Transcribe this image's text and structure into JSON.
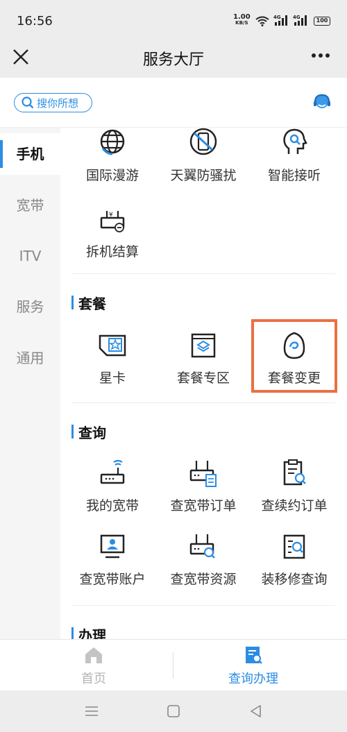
{
  "status_bar": {
    "time": "16:56",
    "speed": "1.00",
    "speed_unit": "KB/S",
    "signal1": "4G",
    "signal2": "4G",
    "battery": "100"
  },
  "header": {
    "title": "服务大厅",
    "close_icon": "close-icon",
    "more_icon": "more-icon"
  },
  "search": {
    "placeholder": "搜你所想",
    "icon": "search-icon",
    "service_icon": "customer-service-icon"
  },
  "sidebar": {
    "items": [
      {
        "label": "手机",
        "active": true
      },
      {
        "label": "宽带"
      },
      {
        "label": "ITV"
      },
      {
        "label": "服务"
      },
      {
        "label": "通用"
      }
    ]
  },
  "main": {
    "top_items": [
      {
        "label": "国际漫游",
        "icon": "globe-icon"
      },
      {
        "label": "天翼防骚扰",
        "icon": "phone-block-icon"
      },
      {
        "label": "智能接听",
        "icon": "ai-head-icon"
      },
      {
        "label": "拆机结算",
        "icon": "router-settle-icon"
      }
    ],
    "package_section": {
      "title": "套餐",
      "items": [
        {
          "label": "星卡",
          "icon": "sim-star-icon"
        },
        {
          "label": "套餐专区",
          "icon": "package-box-icon"
        },
        {
          "label": "套餐变更",
          "icon": "egg-swirl-icon"
        }
      ]
    },
    "query_section": {
      "title": "查询",
      "items": [
        {
          "label": "我的宽带",
          "icon": "router-wifi-icon"
        },
        {
          "label": "查宽带订单",
          "icon": "router-doc-icon"
        },
        {
          "label": "查续约订单",
          "icon": "clipboard-search-icon"
        },
        {
          "label": "查宽带账户",
          "icon": "monitor-user-icon"
        },
        {
          "label": "查宽带资源",
          "icon": "router-search-icon"
        },
        {
          "label": "装移修查询",
          "icon": "list-search-icon"
        }
      ]
    },
    "handle_section": {
      "title": "办理"
    }
  },
  "tab_bar": {
    "tabs": [
      {
        "label": "首页",
        "icon": "home-icon"
      },
      {
        "label": "查询办理",
        "icon": "query-handle-icon",
        "active": true
      }
    ]
  },
  "colors": {
    "accent": "#2b8de3",
    "highlight": "#ec6f43"
  }
}
